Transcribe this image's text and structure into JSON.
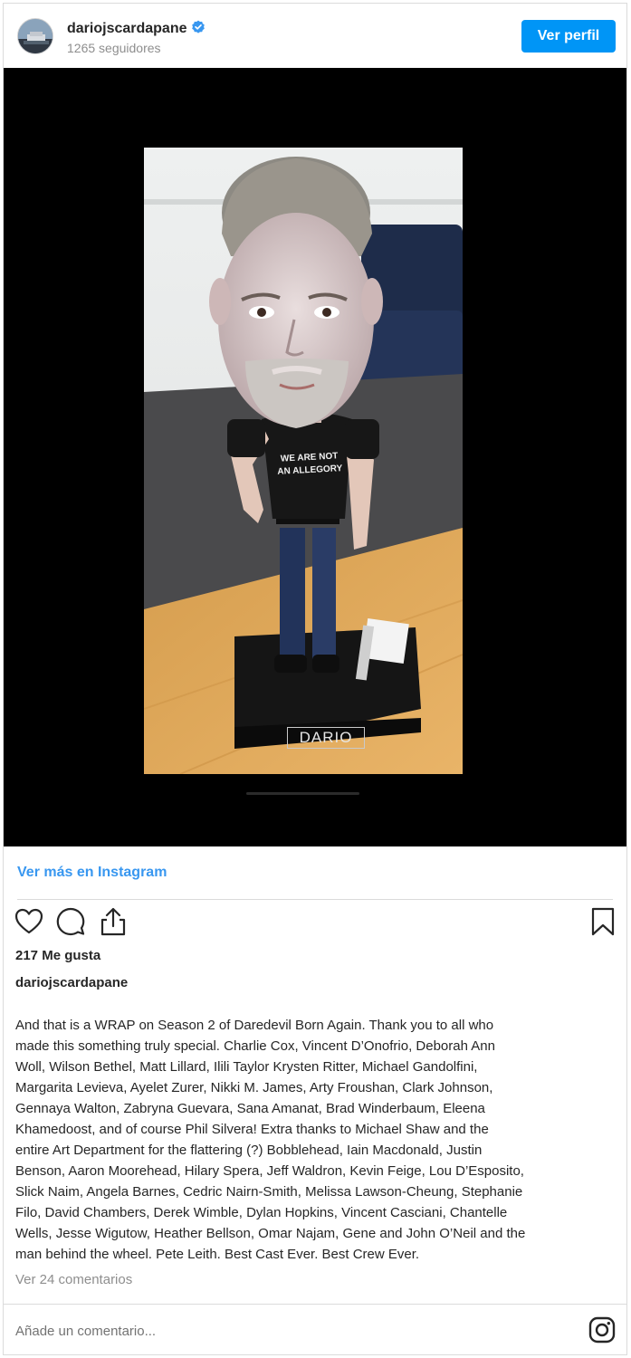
{
  "header": {
    "username": "dariojscardapane",
    "followers": "1265 seguidores",
    "profile_button": "Ver perfil"
  },
  "media": {
    "figurine_shirt_line1": "WE ARE NOT",
    "figurine_shirt_line2": "AN ALLEGORY",
    "figurine_base_label": "DARIO"
  },
  "links": {
    "view_more": "Ver más en Instagram",
    "view_comments": "Ver 24 comentarios"
  },
  "actions": {
    "like_icon": "heart-icon",
    "comment_icon": "comment-icon",
    "share_icon": "share-icon",
    "save_icon": "bookmark-icon",
    "instagram_icon": "instagram-icon"
  },
  "post": {
    "likes": "217 Me gusta",
    "caption_user": "dariojscardapane",
    "caption_lines": [
      "And that is a WRAP on Season 2 of Daredevil Born Again.  Thank you to all who",
      "made this something truly special.  Charlie Cox, Vincent D’Onofrio, Deborah Ann",
      "Woll, Wilson Bethel, Matt Lillard, Ilili Taylor Krysten Ritter, Michael Gandolfini,",
      "Margarita Levieva, Ayelet Zurer, Nikki M. James, Arty Froushan, Clark Johnson,",
      "Gennaya Walton, Zabryna Guevara, Sana Amanat, Brad Winderbaum, Eleena",
      "Khamedoost, and of course Phil Silvera!  Extra thanks to Michael Shaw and the",
      "entire Art Department for the flattering (?) Bobblehead, Iain Macdonald, Justin",
      "Benson, Aaron Moorehead, Hilary Spera, Jeff Waldron, Kevin Feige, Lou D’Esposito,",
      "Slick Naim, Angela Barnes, Cedric Nairn-Smith, Melissa Lawson-Cheung, Stephanie",
      "Filo, David Chambers, Derek Wimble, Dylan Hopkins, Vincent Casciani, Chantelle",
      "Wells, Jesse Wigutow, Heather Bellson, Omar Najam, Gene and John O’Neil and the",
      "man behind the wheel. Pete Leith. Best Cast Ever.  Best Crew Ever."
    ]
  },
  "comment_box": {
    "placeholder": "Añade un comentario..."
  },
  "colors": {
    "accent": "#0095f6",
    "link": "#3897f0",
    "media_background": "#000000"
  }
}
